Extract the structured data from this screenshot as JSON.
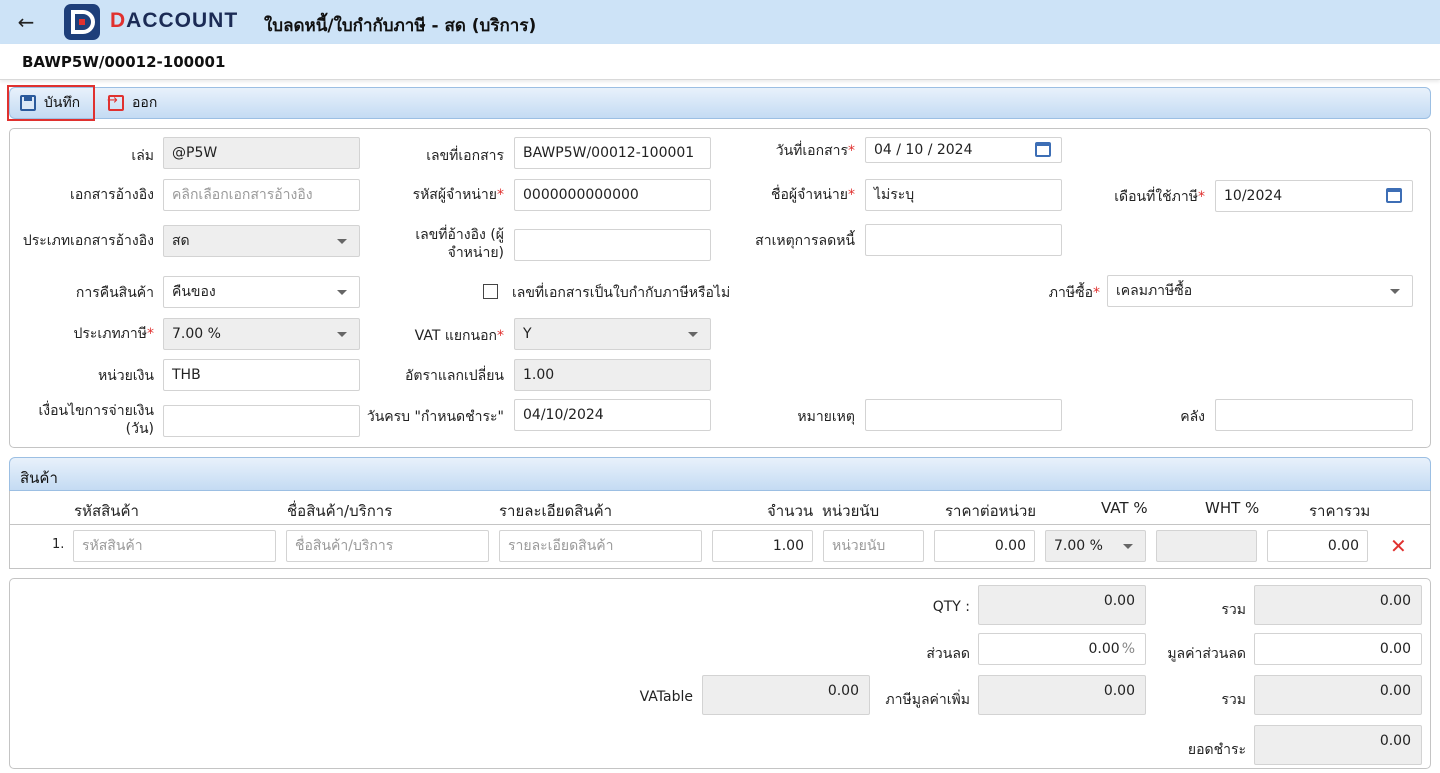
{
  "header": {
    "brand_d": "D",
    "brand_rest": "ACCOUNT",
    "title": "ใบลดหนี้/ใบกำกับภาษี - สด (บริการ)",
    "back_icon": "arrow-left-icon",
    "logo_icon": "daccount-logo-icon"
  },
  "doc": {
    "number": "BAWP5W/00012-100001"
  },
  "toolbar": {
    "save_label": "บันทึก",
    "exit_label": "ออก",
    "save_icon": "floppy-disk-icon",
    "exit_icon": "exit-icon"
  },
  "form": {
    "book": {
      "label": "เล่ม",
      "value": "@P5W"
    },
    "doc_no": {
      "label": "เลขที่เอกสาร",
      "value": "BAWP5W/00012-100001"
    },
    "doc_date": {
      "label": "วันที่เอกสาร",
      "value": "04 / 10 /  2024"
    },
    "ref_doc": {
      "label": "เอกสารอ้างอิง",
      "placeholder": "คลิกเลือกเอกสารอ้างอิง"
    },
    "vendor_code": {
      "label": "รหัสผู้จำหน่าย",
      "value": "0000000000000"
    },
    "vendor_name": {
      "label": "ชื่อผู้จำหน่าย",
      "value": "ไม่ระบุ"
    },
    "tax_month": {
      "label": "เดือนที่ใช้ภาษี",
      "value": "10/2024"
    },
    "ref_doc_type": {
      "label": "ประเภทเอกสารอ้างอิง",
      "value": "สด"
    },
    "ref_no": {
      "label_line1": "เลขที่อ้างอิง (ผู้",
      "label_line2": "จำหน่าย)",
      "value": ""
    },
    "reason": {
      "label": "สาเหตุการลดหนี้",
      "value": ""
    },
    "return_goods": {
      "label": "การคืนสินค้า",
      "value": "คืนของ"
    },
    "is_tax_invoice": {
      "label": "เลขที่เอกสารเป็นใบกำกับภาษีหรือไม่",
      "checked": false
    },
    "purchase_tax": {
      "label": "ภาษีซื้อ",
      "value": "เคลมภาษีซื้อ"
    },
    "tax_type": {
      "label": "ประเภทภาษี",
      "value": "7.00 %"
    },
    "vat_separate": {
      "label": "VAT แยกนอก",
      "value": "Y"
    },
    "currency": {
      "label": "หน่วยเงิน",
      "value": "THB"
    },
    "exchange_rate": {
      "label": "อัตราแลกเปลี่ยน",
      "value": "1.00"
    },
    "payment_terms": {
      "label_line1": "เงื่อนไขการจ่ายเงิน",
      "label_line2": "(วัน)",
      "value": ""
    },
    "due_date": {
      "label": "วันครบ \"กำหนดชำระ\"",
      "value": "04/10/2024"
    },
    "note": {
      "label": "หมายเหตุ",
      "value": ""
    },
    "warehouse": {
      "label": "คลัง",
      "value": ""
    }
  },
  "items": {
    "section_title": "สินค้า",
    "columns": [
      "รหัสสินค้า",
      "ชื่อสินค้า/บริการ",
      "รายละเอียดสินค้า",
      "จำนวน",
      "หน่วยนับ",
      "ราคาต่อหน่วย",
      "VAT %",
      "WHT %",
      "ราคารวม"
    ],
    "rows": [
      {
        "no": "1.",
        "code_placeholder": "รหัสสินค้า",
        "name_placeholder": "ชื่อสินค้า/บริการ",
        "detail_placeholder": "รายละเอียดสินค้า",
        "qty": "1.00",
        "unit_placeholder": "หน่วยนับ",
        "price": "0.00",
        "vat": "7.00 %",
        "wht": "",
        "total": "0.00",
        "delete_icon": "delete-x-icon"
      }
    ]
  },
  "totals": {
    "qty_label": "QTY :",
    "qty_value": "0.00",
    "sum_label": "รวม",
    "sum_value": "0.00",
    "discount_label": "ส่วนลด",
    "discount_value": "0.00",
    "discount_unit": "%",
    "discount_amount_label": "มูลค่าส่วนลด",
    "discount_amount_value": "0.00",
    "vatable_label": "VATable",
    "vatable_value": "0.00",
    "vat_label": "ภาษีมูลค่าเพิ่ม",
    "vat_value": "0.00",
    "sum2_label": "รวม",
    "sum2_value": "0.00",
    "net_label": "ยอดชำระ",
    "net_value": "0.00"
  }
}
